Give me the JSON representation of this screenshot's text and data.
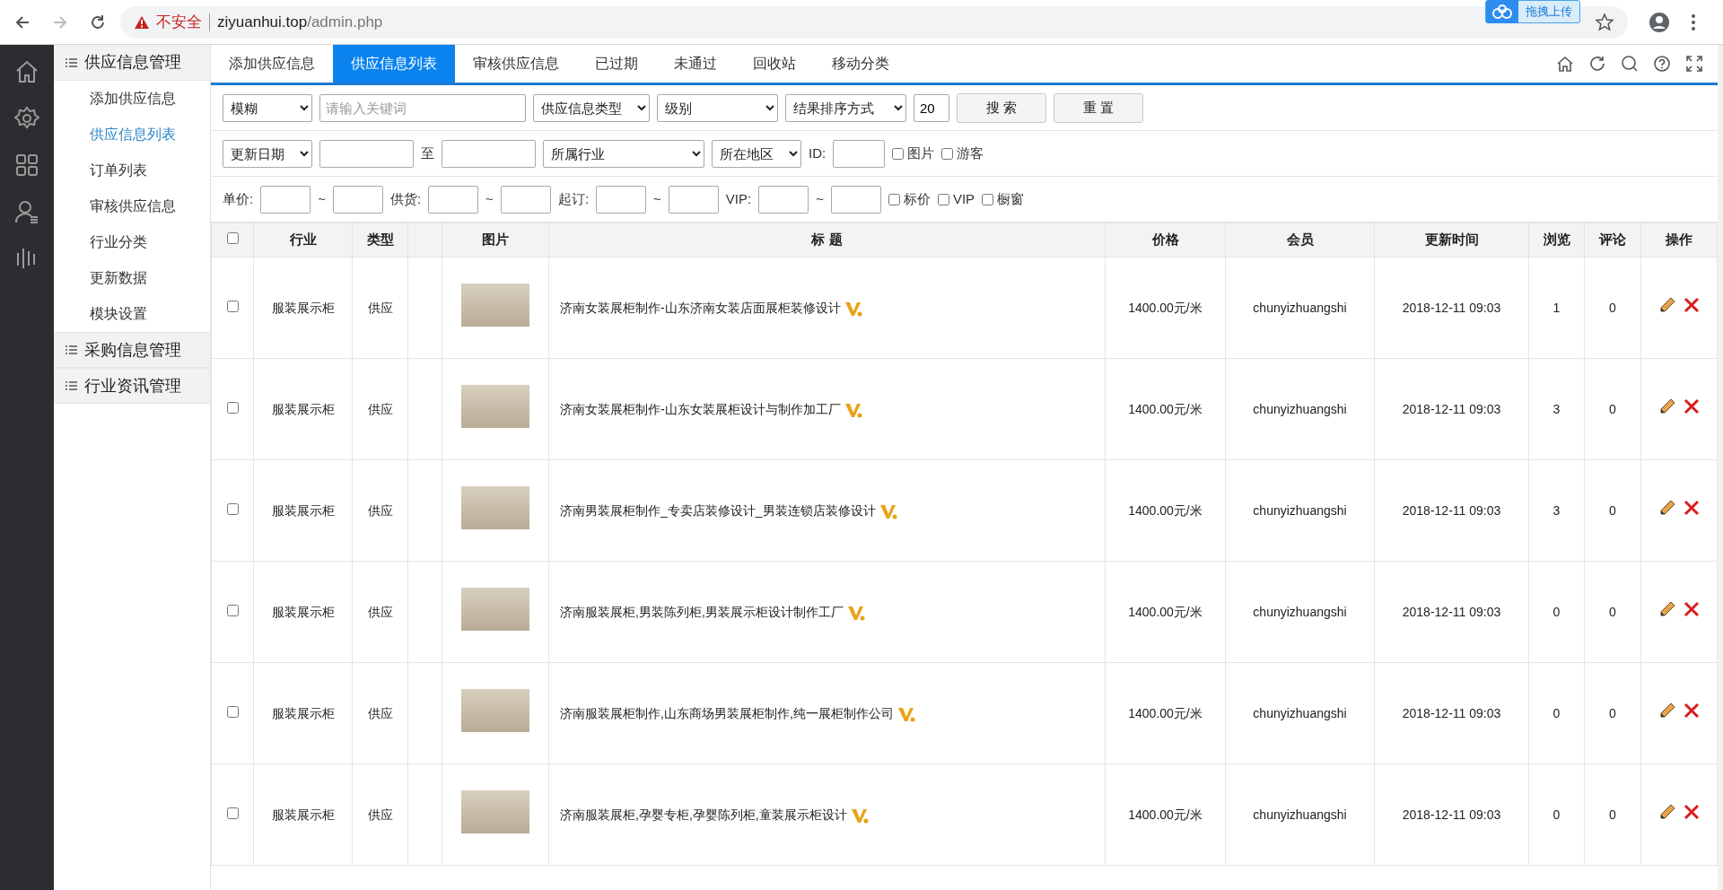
{
  "browser": {
    "security_label": "不安全",
    "url_host": "ziyuanhui.top",
    "url_path": "/admin.php",
    "extension_label": "拖拽上传"
  },
  "sidebar": {
    "groups": [
      {
        "label": "供应信息管理",
        "expanded": true,
        "children": [
          {
            "label": "添加供应信息",
            "selected": false
          },
          {
            "label": "供应信息列表",
            "selected": true
          },
          {
            "label": "订单列表",
            "selected": false
          },
          {
            "label": "审核供应信息",
            "selected": false
          },
          {
            "label": "行业分类",
            "selected": false
          },
          {
            "label": "更新数据",
            "selected": false
          },
          {
            "label": "模块设置",
            "selected": false
          }
        ]
      },
      {
        "label": "采购信息管理",
        "expanded": false
      },
      {
        "label": "行业资讯管理",
        "expanded": false
      }
    ]
  },
  "tabs": [
    {
      "label": "添加供应信息",
      "selected": false
    },
    {
      "label": "供应信息列表",
      "selected": true
    },
    {
      "label": "审核供应信息",
      "selected": false
    },
    {
      "label": "已过期",
      "selected": false
    },
    {
      "label": "未通过",
      "selected": false
    },
    {
      "label": "回收站",
      "selected": false
    },
    {
      "label": "移动分类",
      "selected": false
    }
  ],
  "filters": [
    [
      {
        "kind": "select",
        "label": "模糊"
      },
      {
        "kind": "input",
        "placeholder": "请输入关键词"
      },
      {
        "kind": "select",
        "label": "供应信息类型"
      },
      {
        "kind": "select",
        "label": "级别"
      },
      {
        "kind": "select",
        "label": "结果排序方式"
      },
      {
        "kind": "input",
        "value": "20"
      },
      {
        "kind": "button",
        "label": "搜 索"
      },
      {
        "kind": "button",
        "label": "重 置"
      }
    ],
    [
      {
        "kind": "select",
        "label": "更新日期"
      },
      {
        "kind": "input"
      },
      {
        "kind": "text",
        "label": "至"
      },
      {
        "kind": "input"
      },
      {
        "kind": "select",
        "label": "所属行业"
      },
      {
        "kind": "select",
        "label": "所在地区"
      },
      {
        "kind": "text",
        "label": "ID:"
      },
      {
        "kind": "input"
      },
      {
        "kind": "checkbox",
        "label": "图片",
        "checked": false
      },
      {
        "kind": "checkbox",
        "label": "游客",
        "checked": false
      }
    ],
    [
      {
        "kind": "text",
        "label": "单价:"
      },
      {
        "kind": "input"
      },
      {
        "kind": "text",
        "label": "~"
      },
      {
        "kind": "input"
      },
      {
        "kind": "text",
        "label": "供货:"
      },
      {
        "kind": "input"
      },
      {
        "kind": "text",
        "label": "~"
      },
      {
        "kind": "input"
      },
      {
        "kind": "text",
        "label": "起订:"
      },
      {
        "kind": "input"
      },
      {
        "kind": "text",
        "label": "~"
      },
      {
        "kind": "input"
      },
      {
        "kind": "text",
        "label": "VIP:"
      },
      {
        "kind": "input"
      },
      {
        "kind": "text",
        "label": "~"
      },
      {
        "kind": "input"
      },
      {
        "kind": "checkbox",
        "label": "标价",
        "checked": false
      },
      {
        "kind": "checkbox",
        "label": "VIP",
        "checked": false
      },
      {
        "kind": "checkbox",
        "label": "橱窗",
        "checked": false
      }
    ]
  ],
  "table": {
    "select_all": {
      "checked": false
    },
    "columns": [
      {
        "kind": "text",
        "label": "行业"
      },
      {
        "kind": "text",
        "label": "类型"
      },
      {
        "kind": "blank"
      },
      {
        "kind": "text",
        "label": "图片"
      },
      {
        "kind": "text",
        "label": "标 题"
      },
      {
        "kind": "text",
        "label": "价格"
      },
      {
        "kind": "text",
        "label": "会员"
      },
      {
        "kind": "text",
        "label": "更新时间"
      },
      {
        "kind": "text",
        "label": "浏览"
      },
      {
        "kind": "text",
        "label": "评论"
      },
      {
        "kind": "text",
        "label": "操作"
      }
    ],
    "rows": [
      {
        "checked": false,
        "industry": "服装展示柜",
        "type": "供应",
        "title": "济南女装展柜制作-山东济南女装店面展柜装修设计",
        "vip": true,
        "price": "1400.00元/米",
        "member": "chunyizhuangshi",
        "updated": "2018-12-11 09:03",
        "views": "1",
        "comments": "0"
      },
      {
        "checked": false,
        "industry": "服装展示柜",
        "type": "供应",
        "title": "济南女装展柜制作-山东女装展柜设计与制作加工厂",
        "vip": true,
        "price": "1400.00元/米",
        "member": "chunyizhuangshi",
        "updated": "2018-12-11 09:03",
        "views": "3",
        "comments": "0"
      },
      {
        "checked": false,
        "industry": "服装展示柜",
        "type": "供应",
        "title": "济南男装展柜制作_专卖店装修设计_男装连锁店装修设计",
        "vip": true,
        "price": "1400.00元/米",
        "member": "chunyizhuangshi",
        "updated": "2018-12-11 09:03",
        "views": "3",
        "comments": "0"
      },
      {
        "checked": false,
        "industry": "服装展示柜",
        "type": "供应",
        "title": "济南服装展柜,男装陈列柜,男装展示柜设计制作工厂",
        "vip": true,
        "price": "1400.00元/米",
        "member": "chunyizhuangshi",
        "updated": "2018-12-11 09:03",
        "views": "0",
        "comments": "0"
      },
      {
        "checked": false,
        "industry": "服装展示柜",
        "type": "供应",
        "title": "济南服装展柜制作,山东商场男装展柜制作,纯一展柜制作公司",
        "vip": true,
        "price": "1400.00元/米",
        "member": "chunyizhuangshi",
        "updated": "2018-12-11 09:03",
        "views": "0",
        "comments": "0"
      },
      {
        "checked": false,
        "industry": "服装展示柜",
        "type": "供应",
        "title": "济南服装展柜,孕婴专柜,孕婴陈列柜,童装展示柜设计",
        "vip": true,
        "price": "1400.00元/米",
        "member": "chunyizhuangshi",
        "updated": "2018-12-11 09:03",
        "views": "0",
        "comments": "0"
      }
    ]
  }
}
